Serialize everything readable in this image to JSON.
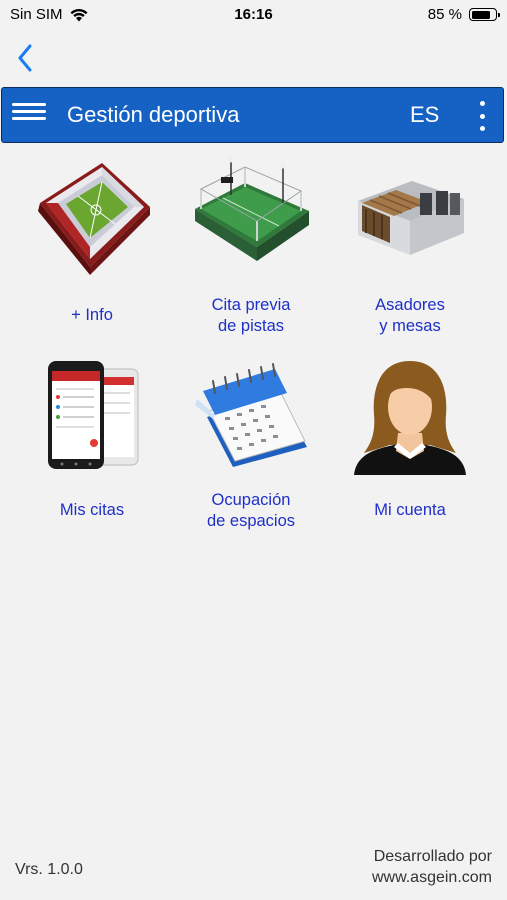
{
  "status_bar": {
    "carrier": "Sin SIM",
    "time": "16:16",
    "battery": "85 %",
    "battery_level": 0.85
  },
  "nav": {
    "back_icon": "chevron-left-icon"
  },
  "app_bar": {
    "menu_icon": "hamburger-menu-icon",
    "title": "Gestión deportiva",
    "language": "ES",
    "more_icon": "more-vertical-icon"
  },
  "tiles": [
    {
      "label": "+ Info",
      "icon": "stadium-icon"
    },
    {
      "label": "Cita previa\nde pistas",
      "icon": "padel-court-icon"
    },
    {
      "label": "Asadores\ny mesas",
      "icon": "barbecue-building-icon"
    },
    {
      "label": "Mis citas",
      "icon": "smartphone-app-icon"
    },
    {
      "label": "Ocupación\nde espacios",
      "icon": "calendar-icon"
    },
    {
      "label": "Mi cuenta",
      "icon": "user-avatar-icon"
    }
  ],
  "footer": {
    "version": "Vrs. 1.0.0",
    "developed_by": "Desarrollado por",
    "website": "www.asgein.com"
  },
  "colors": {
    "app_bar": "#1662c4",
    "tile_label": "#1f30c8",
    "back_arrow": "#1a7cf5",
    "background": "#f2f2f2"
  }
}
